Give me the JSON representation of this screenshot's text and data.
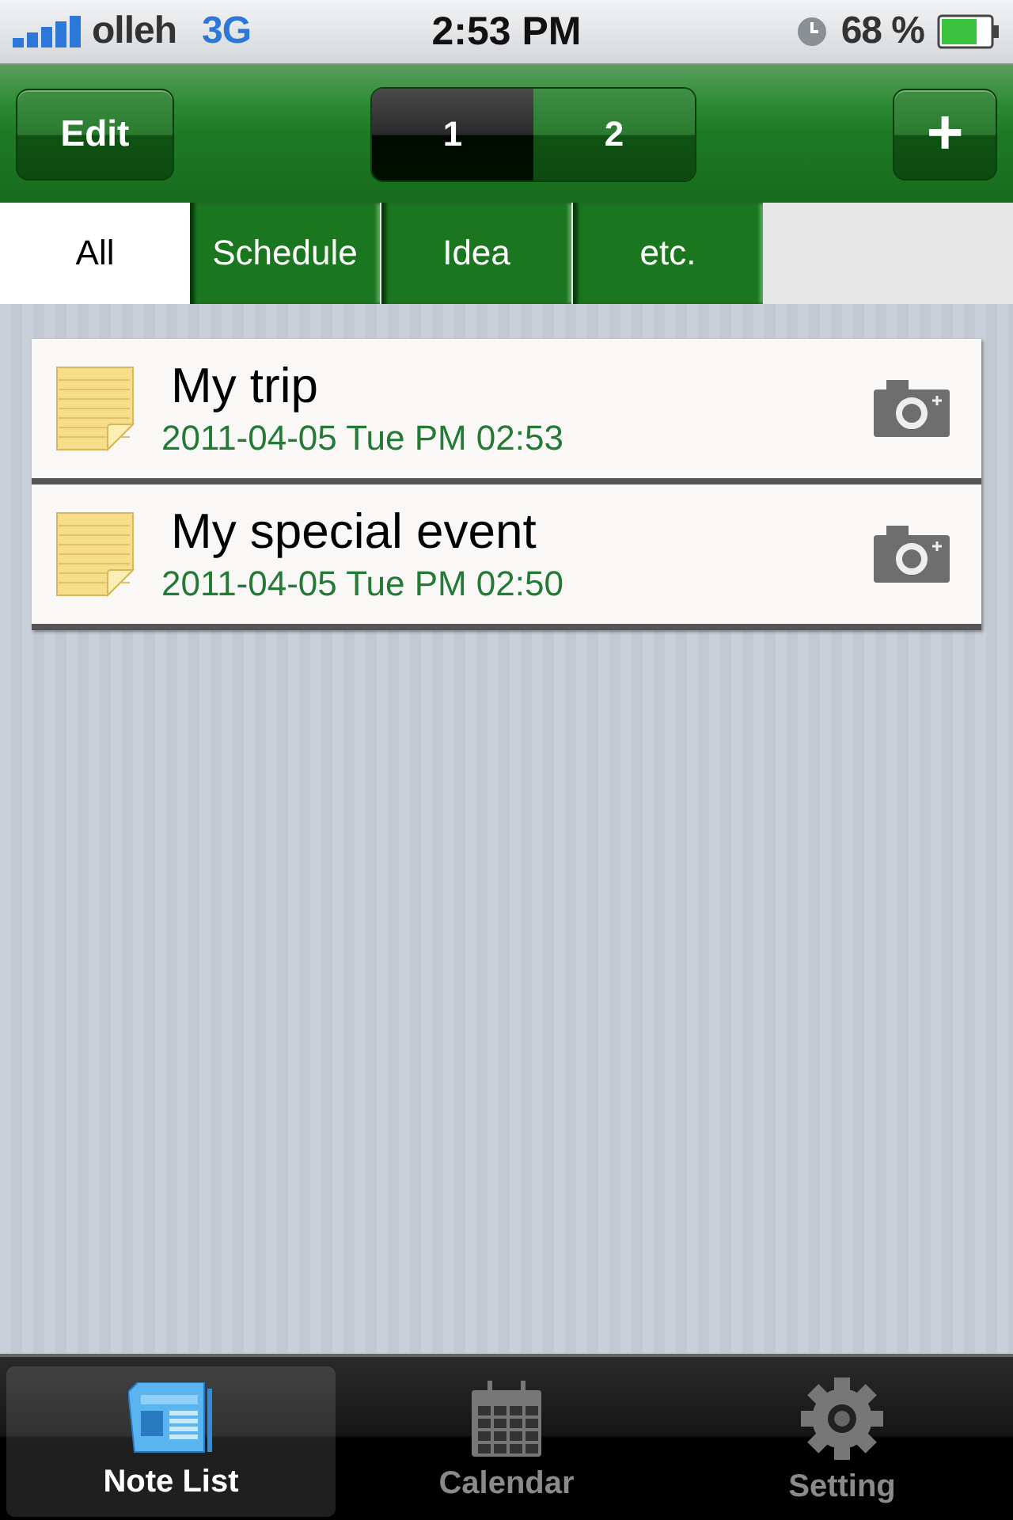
{
  "status_bar": {
    "carrier": "olleh",
    "network": "3G",
    "time": "2:53 PM",
    "battery": "68 %"
  },
  "nav_bar": {
    "edit_button": "Edit",
    "segments": [
      {
        "label": "1",
        "selected": true
      },
      {
        "label": "2",
        "selected": false
      }
    ],
    "add_button": "+"
  },
  "categories": [
    {
      "label": "All",
      "selected": true
    },
    {
      "label": "Schedule",
      "selected": false
    },
    {
      "label": "Idea",
      "selected": false
    },
    {
      "label": "etc.",
      "selected": false
    }
  ],
  "notes": [
    {
      "title": "My trip",
      "date": "2011-04-05 Tue PM 02:53"
    },
    {
      "title": "My special event",
      "date": "2011-04-05 Tue PM 02:50"
    }
  ],
  "tab_bar": [
    {
      "label": "Note List",
      "kind": "notes",
      "selected": true
    },
    {
      "label": "Calendar",
      "kind": "calendar",
      "selected": false
    },
    {
      "label": "Setting",
      "kind": "settings",
      "selected": false
    }
  ]
}
